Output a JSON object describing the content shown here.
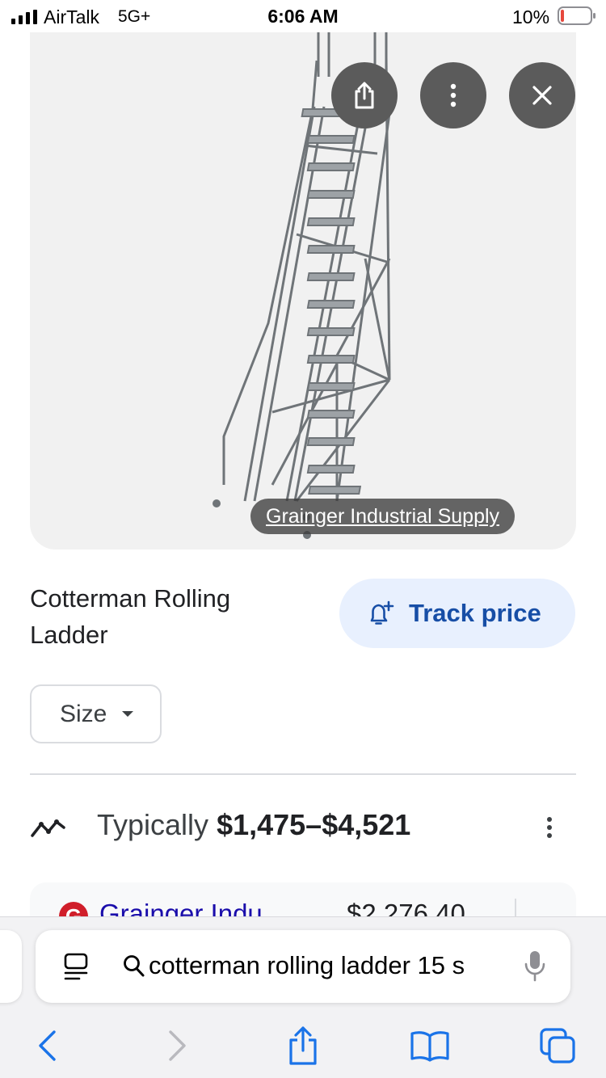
{
  "status_bar": {
    "carrier": "AirTalk",
    "network": "5G+",
    "time": "6:06 AM",
    "battery_percent": "10%",
    "battery_level": 0.1,
    "battery_color": "#e6483d"
  },
  "image_viewer": {
    "icons": [
      "share-icon",
      "more-vertical-icon",
      "close-icon"
    ],
    "source_label": "Grainger Industrial Supply"
  },
  "product": {
    "title": "Cotterman Rolling Ladder",
    "track_price_label": "Track price",
    "size_label": "Size"
  },
  "pricing": {
    "prefix": "Typically",
    "range": "$1,475–$4,521"
  },
  "seller_preview": {
    "logo_letter": "G",
    "name": "Grainger Indu",
    "price": "$2,276.40",
    "logo_color": "#d01e2a"
  },
  "safari": {
    "address_text": "cotterman rolling ladder 15 s",
    "toolbar_icons": [
      "back-icon",
      "forward-icon",
      "share-icon",
      "bookmarks-icon",
      "tabs-icon"
    ],
    "accent_color": "#1a73e8"
  }
}
